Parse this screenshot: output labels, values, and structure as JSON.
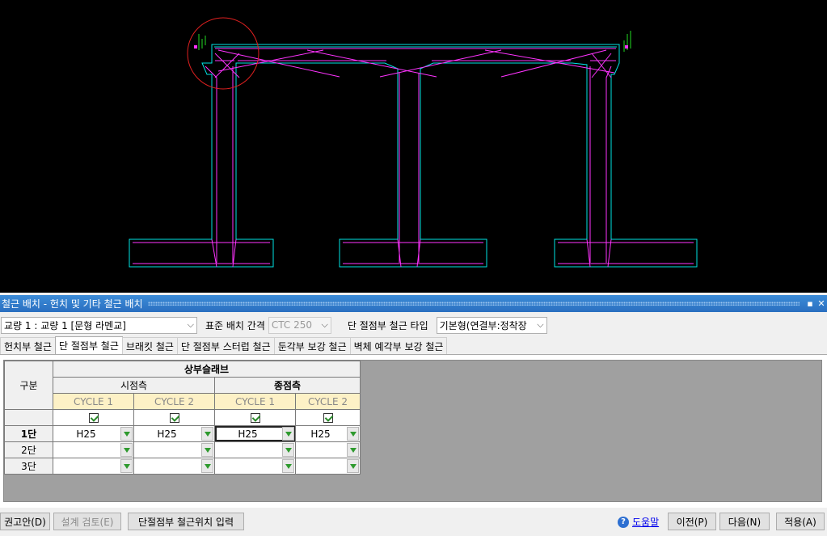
{
  "colors": {
    "cad_bg": "#000000",
    "outline": "#00e5e5",
    "rebar": "#ff33ff",
    "marker": "#e02020",
    "dim": "#22dd22"
  },
  "panel": {
    "title": "철근 배치 - 헌치 및 기타 철근 배치",
    "pin_icon": "pin-icon",
    "close_icon": "close-icon"
  },
  "options": {
    "bridge_select": "교량 1 : 교량 1 [문형 라멘교]",
    "spacing_label": "표준 배치 간격",
    "spacing_value": "CTC 250",
    "type_label": "단 절점부 철근 타입",
    "type_value": "기본형(연결부:정착장"
  },
  "tabs": [
    {
      "label": "헌치부 철근"
    },
    {
      "label": "단 절점부 철근",
      "active": true
    },
    {
      "label": "브래킷 철근"
    },
    {
      "label": "단 절점부 스터럽 철근"
    },
    {
      "label": "둔각부 보강 철근"
    },
    {
      "label": "벽체 예각부 보강 철근"
    }
  ],
  "grid": {
    "col_header_main": "구분",
    "group_header": "상부슬래브",
    "sides": [
      "시점측",
      "종점측"
    ],
    "cycles": [
      "CYCLE 1",
      "CYCLE 2",
      "CYCLE 1",
      "CYCLE 2"
    ],
    "rows": [
      {
        "label": "1단",
        "values": [
          "H25",
          "H25",
          "H25",
          "H25"
        ]
      },
      {
        "label": "2단",
        "values": [
          "",
          "",
          "",
          ""
        ]
      },
      {
        "label": "3단",
        "values": [
          "",
          "",
          "",
          ""
        ]
      }
    ]
  },
  "buttons": {
    "recommend": "권고안(D)",
    "design_review": "설계 검토(E)",
    "node_input": "단절점부 철근위치 입력",
    "help": "도움말",
    "prev": "이전(P)",
    "next": "다음(N)",
    "apply": "적용(A)"
  }
}
